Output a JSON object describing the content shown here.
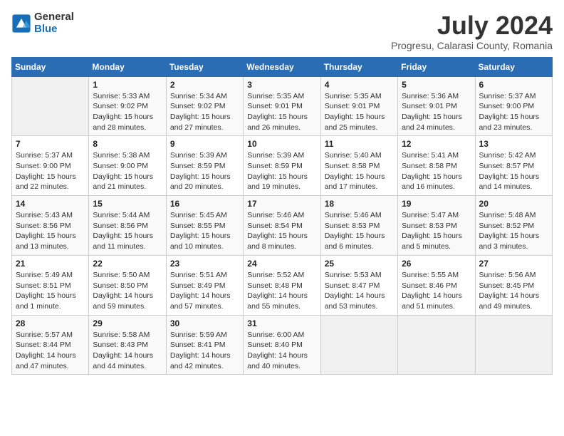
{
  "logo": {
    "general": "General",
    "blue": "Blue"
  },
  "title": "July 2024",
  "location": "Progresu, Calarasi County, Romania",
  "weekdays": [
    "Sunday",
    "Monday",
    "Tuesday",
    "Wednesday",
    "Thursday",
    "Friday",
    "Saturday"
  ],
  "weeks": [
    [
      null,
      {
        "day": 1,
        "sunrise": "5:33 AM",
        "sunset": "9:02 PM",
        "daylight": "15 hours and 28 minutes."
      },
      {
        "day": 2,
        "sunrise": "5:34 AM",
        "sunset": "9:02 PM",
        "daylight": "15 hours and 27 minutes."
      },
      {
        "day": 3,
        "sunrise": "5:35 AM",
        "sunset": "9:01 PM",
        "daylight": "15 hours and 26 minutes."
      },
      {
        "day": 4,
        "sunrise": "5:35 AM",
        "sunset": "9:01 PM",
        "daylight": "15 hours and 25 minutes."
      },
      {
        "day": 5,
        "sunrise": "5:36 AM",
        "sunset": "9:01 PM",
        "daylight": "15 hours and 24 minutes."
      },
      {
        "day": 6,
        "sunrise": "5:37 AM",
        "sunset": "9:00 PM",
        "daylight": "15 hours and 23 minutes."
      }
    ],
    [
      {
        "day": 7,
        "sunrise": "5:37 AM",
        "sunset": "9:00 PM",
        "daylight": "15 hours and 22 minutes."
      },
      {
        "day": 8,
        "sunrise": "5:38 AM",
        "sunset": "9:00 PM",
        "daylight": "15 hours and 21 minutes."
      },
      {
        "day": 9,
        "sunrise": "5:39 AM",
        "sunset": "8:59 PM",
        "daylight": "15 hours and 20 minutes."
      },
      {
        "day": 10,
        "sunrise": "5:39 AM",
        "sunset": "8:59 PM",
        "daylight": "15 hours and 19 minutes."
      },
      {
        "day": 11,
        "sunrise": "5:40 AM",
        "sunset": "8:58 PM",
        "daylight": "15 hours and 17 minutes."
      },
      {
        "day": 12,
        "sunrise": "5:41 AM",
        "sunset": "8:58 PM",
        "daylight": "15 hours and 16 minutes."
      },
      {
        "day": 13,
        "sunrise": "5:42 AM",
        "sunset": "8:57 PM",
        "daylight": "15 hours and 14 minutes."
      }
    ],
    [
      {
        "day": 14,
        "sunrise": "5:43 AM",
        "sunset": "8:56 PM",
        "daylight": "15 hours and 13 minutes."
      },
      {
        "day": 15,
        "sunrise": "5:44 AM",
        "sunset": "8:56 PM",
        "daylight": "15 hours and 11 minutes."
      },
      {
        "day": 16,
        "sunrise": "5:45 AM",
        "sunset": "8:55 PM",
        "daylight": "15 hours and 10 minutes."
      },
      {
        "day": 17,
        "sunrise": "5:46 AM",
        "sunset": "8:54 PM",
        "daylight": "15 hours and 8 minutes."
      },
      {
        "day": 18,
        "sunrise": "5:46 AM",
        "sunset": "8:53 PM",
        "daylight": "15 hours and 6 minutes."
      },
      {
        "day": 19,
        "sunrise": "5:47 AM",
        "sunset": "8:53 PM",
        "daylight": "15 hours and 5 minutes."
      },
      {
        "day": 20,
        "sunrise": "5:48 AM",
        "sunset": "8:52 PM",
        "daylight": "15 hours and 3 minutes."
      }
    ],
    [
      {
        "day": 21,
        "sunrise": "5:49 AM",
        "sunset": "8:51 PM",
        "daylight": "15 hours and 1 minute."
      },
      {
        "day": 22,
        "sunrise": "5:50 AM",
        "sunset": "8:50 PM",
        "daylight": "14 hours and 59 minutes."
      },
      {
        "day": 23,
        "sunrise": "5:51 AM",
        "sunset": "8:49 PM",
        "daylight": "14 hours and 57 minutes."
      },
      {
        "day": 24,
        "sunrise": "5:52 AM",
        "sunset": "8:48 PM",
        "daylight": "14 hours and 55 minutes."
      },
      {
        "day": 25,
        "sunrise": "5:53 AM",
        "sunset": "8:47 PM",
        "daylight": "14 hours and 53 minutes."
      },
      {
        "day": 26,
        "sunrise": "5:55 AM",
        "sunset": "8:46 PM",
        "daylight": "14 hours and 51 minutes."
      },
      {
        "day": 27,
        "sunrise": "5:56 AM",
        "sunset": "8:45 PM",
        "daylight": "14 hours and 49 minutes."
      }
    ],
    [
      {
        "day": 28,
        "sunrise": "5:57 AM",
        "sunset": "8:44 PM",
        "daylight": "14 hours and 47 minutes."
      },
      {
        "day": 29,
        "sunrise": "5:58 AM",
        "sunset": "8:43 PM",
        "daylight": "14 hours and 44 minutes."
      },
      {
        "day": 30,
        "sunrise": "5:59 AM",
        "sunset": "8:41 PM",
        "daylight": "14 hours and 42 minutes."
      },
      {
        "day": 31,
        "sunrise": "6:00 AM",
        "sunset": "8:40 PM",
        "daylight": "14 hours and 40 minutes."
      },
      null,
      null,
      null
    ]
  ]
}
